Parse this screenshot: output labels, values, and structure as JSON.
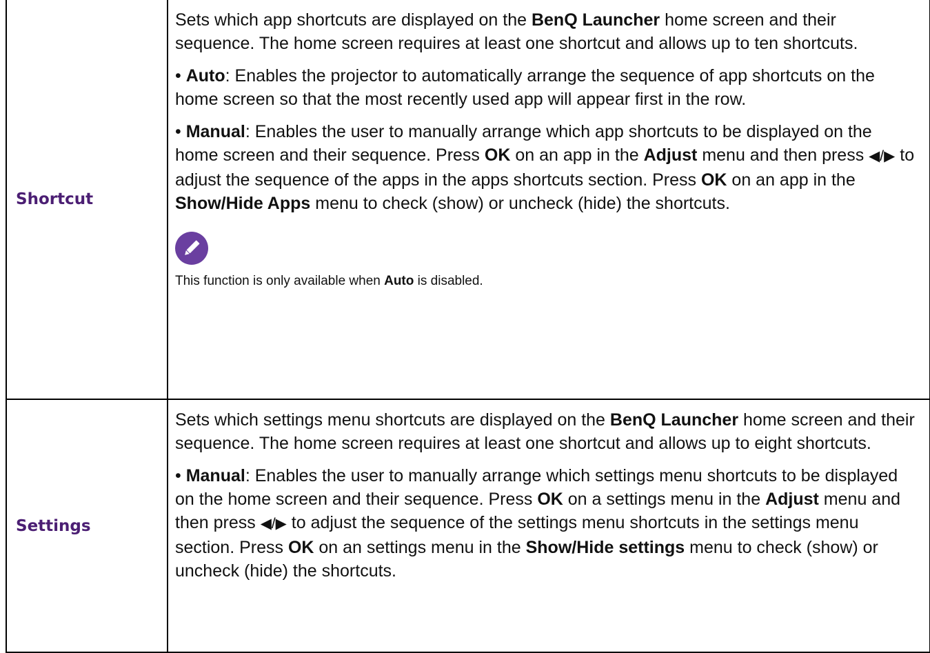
{
  "rows": [
    {
      "label": "Shortcut",
      "intro": {
        "t1": "Sets which app shortcuts are displayed on the ",
        "b1": "BenQ Launcher",
        "t2": " home screen and their sequence. The home screen requires at least one shortcut and allows up to ten shortcuts."
      },
      "auto_bullet": {
        "term": "Auto",
        "text": ": Enables the projector to automatically arrange the sequence of app shortcuts on the home screen so that the most recently used app will appear first in the row."
      },
      "manual_bullet": {
        "term": "Manual",
        "t1": ": Enables the user to manually arrange which app shortcuts to be displayed on the home screen and their sequence. Press ",
        "b1": "OK",
        "t2": " on an app in the ",
        "b2": "Adjust",
        "t3": " menu and then press ",
        "arrows": "◀/▶",
        "t4": " to adjust the sequence of the apps in the apps shortcuts section. Press ",
        "b3": "OK",
        "t5": " on an app in the ",
        "b4": "Show/Hide Apps",
        "t6": " menu to check (show) or uncheck (hide) the shortcuts."
      },
      "note": {
        "icon": "pencil-note-icon",
        "t1": "This function is only available when ",
        "b1": "Auto",
        "t2": " is disabled."
      }
    },
    {
      "label": "Settings",
      "intro": {
        "t1": "Sets which settings menu shortcuts are displayed on the ",
        "b1": "BenQ Launcher",
        "t2": " home screen and their sequence. The home screen requires at least one shortcut and allows up to eight shortcuts."
      },
      "manual_bullet": {
        "term": "Manual",
        "t1": ": Enables the user to manually arrange which settings menu shortcuts to be displayed on the home screen and their sequence. Press ",
        "b1": "OK",
        "t2": " on a settings menu in the ",
        "b2": "Adjust",
        "t3": " menu and then press ",
        "arrows": "◀/▶",
        "t4": " to adjust the sequence of the settings menu shortcuts in the settings menu section. Press ",
        "b3": "OK",
        "t5": " on an settings menu in the ",
        "b4": "Show/Hide settings",
        "t6": " menu to check (show) or uncheck (hide) the shortcuts."
      }
    }
  ],
  "colors": {
    "label": "#4b1e73",
    "note_icon": "#6a3fa0",
    "border": "#000000"
  }
}
